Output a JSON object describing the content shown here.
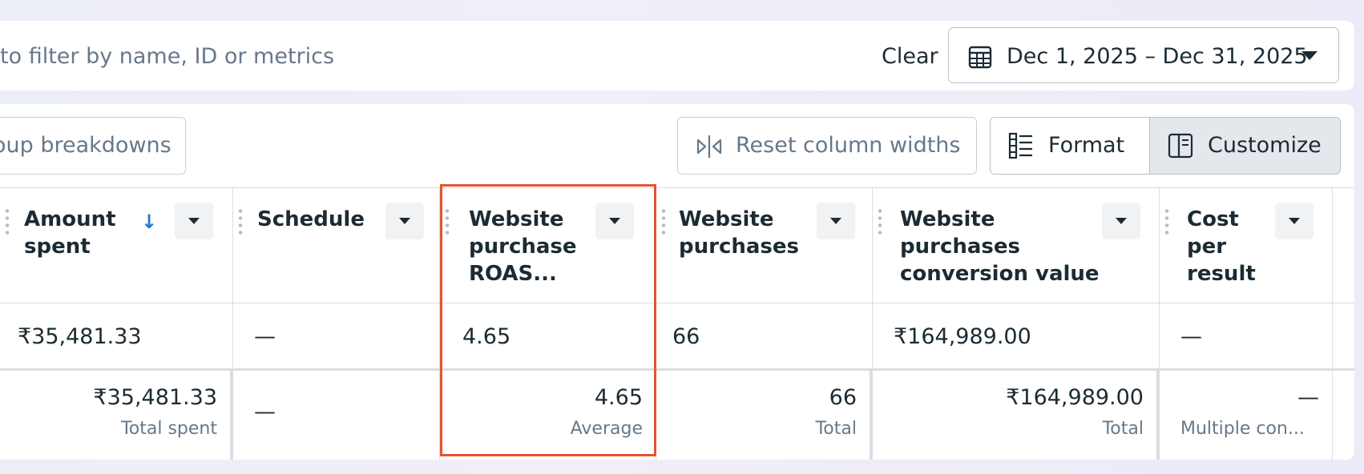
{
  "filter": {
    "text": "to filter by name, ID or metrics"
  },
  "clear_label": "Clear",
  "date_range": {
    "label": "Dec 1, 2025 – Dec 31, 2025"
  },
  "toolbar": {
    "group_breakdowns": "oup breakdowns",
    "reset_widths": "Reset column widths",
    "format": "Format",
    "customize": "Customize"
  },
  "columns": [
    {
      "title": "Amount spent",
      "row_value": "₹35,481.33",
      "total_value": "₹35,481.33",
      "total_label": "Total spent",
      "sorted": true
    },
    {
      "title": "Schedule",
      "row_value": "—",
      "total_value": "—",
      "total_label": ""
    },
    {
      "title": "Website purchase ROAS...",
      "row_value": "4.65",
      "total_value": "4.65",
      "total_label": "Average"
    },
    {
      "title": "Website purchases",
      "row_value": "66",
      "total_value": "66",
      "total_label": "Total"
    },
    {
      "title": "Website purchases conversion value",
      "row_value": "₹164,989.00",
      "total_value": "₹164,989.00",
      "total_label": "Total"
    },
    {
      "title": "Cost per result",
      "row_value": "—",
      "total_value": "—",
      "total_label": "Multiple con..."
    }
  ],
  "colors": {
    "highlight": "#e35530",
    "sort_arrow": "#1d7bd6"
  },
  "icons": [
    "calendar-icon",
    "caret-down-icon",
    "column-resize-icon",
    "format-icon",
    "customize-icon",
    "sort-descending-icon",
    "drag-handle-icon"
  ]
}
